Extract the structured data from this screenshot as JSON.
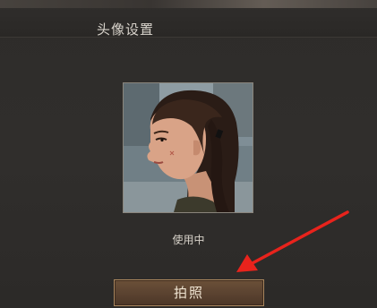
{
  "header": {
    "title": "头像设置"
  },
  "avatar": {
    "status_label": "使用中"
  },
  "actions": {
    "take_photo_label": "拍照"
  },
  "colors": {
    "background": "#2e2c2a",
    "button_fill": "#5a4230",
    "button_border": "#a9865e",
    "annotation_arrow": "#e8231c"
  }
}
